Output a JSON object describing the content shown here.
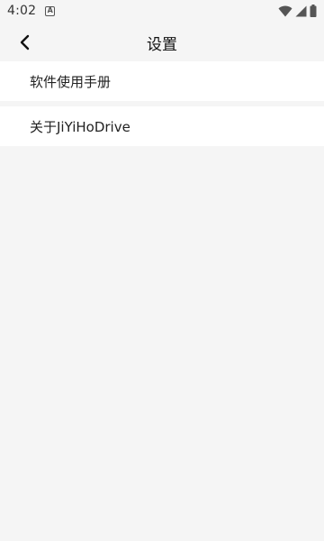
{
  "status_bar": {
    "time": "4:02",
    "notification_icon": "a-icon",
    "wifi_icon": "wifi-icon",
    "signal_icon": "signal-icon",
    "battery_icon": "battery-icon"
  },
  "app_bar": {
    "title": "设置",
    "back_icon": "chevron-left-icon"
  },
  "settings": {
    "items": [
      {
        "label": "软件使用手册"
      },
      {
        "label": "关于JiYiHoDrive"
      }
    ]
  },
  "colors": {
    "background": "#f5f5f5",
    "item_background": "#ffffff",
    "text": "#222222"
  }
}
